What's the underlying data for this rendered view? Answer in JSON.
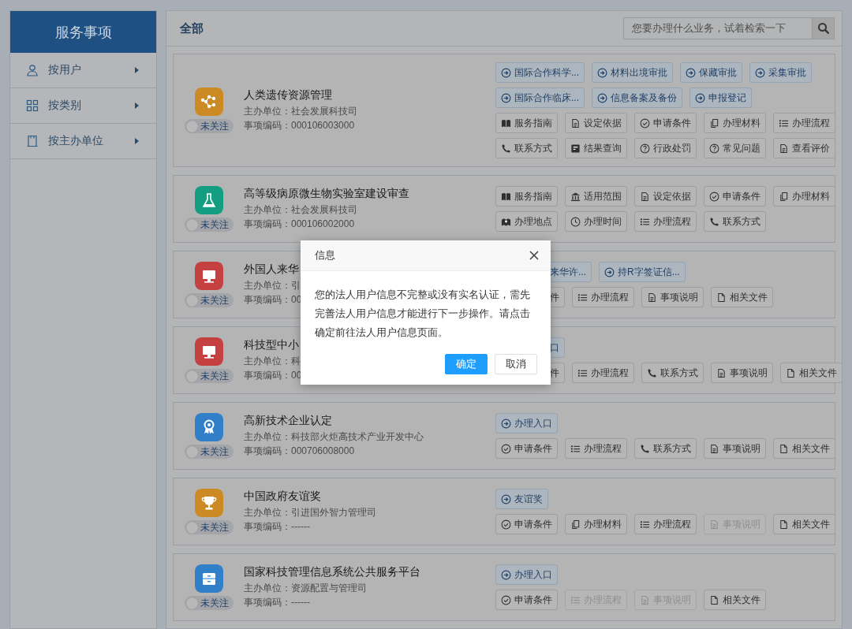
{
  "sidebar": {
    "title": "服务事项",
    "items": [
      {
        "label": "按用户",
        "kind": "user"
      },
      {
        "label": "按类别",
        "kind": "grid"
      },
      {
        "label": "按主办单位",
        "kind": "building"
      }
    ]
  },
  "main": {
    "title": "全部",
    "search": {
      "placeholder": "您要办理什么业务，试着检索一下"
    }
  },
  "items": [
    {
      "title": "人类遗传资源管理",
      "org": "主办单位：社会发展科技司",
      "code": "事项编码：000106003000",
      "kind": "molecule",
      "color": "#cc8a25",
      "follow_label": "未关注",
      "followed": false,
      "button_rows": [
        [
          {
            "label": "国际合作科学...",
            "kind": "entry",
            "disabled": false,
            "clipped": false
          },
          {
            "label": "材料出境审批",
            "kind": "entry",
            "disabled": false,
            "clipped": false
          },
          {
            "label": "保藏审批",
            "kind": "entry",
            "disabled": false,
            "clipped": false
          },
          {
            "label": "采集审批",
            "kind": "entry",
            "disabled": false,
            "clipped": false
          }
        ],
        [
          {
            "label": "国际合作临床...",
            "kind": "entry",
            "disabled": false,
            "clipped": false
          },
          {
            "label": "信息备案及备份",
            "kind": "entry",
            "disabled": false,
            "clipped": false
          },
          {
            "label": "申报登记",
            "kind": "entry",
            "disabled": false,
            "clipped": false
          }
        ],
        [
          {
            "label": "服务指南",
            "kind": "guide",
            "disabled": false,
            "clipped": false
          },
          {
            "label": "设定依据",
            "kind": "doc",
            "disabled": false,
            "clipped": false
          },
          {
            "label": "申请条件",
            "kind": "check",
            "disabled": false,
            "clipped": false
          },
          {
            "label": "办理材料",
            "kind": "copy",
            "disabled": false,
            "clipped": false
          },
          {
            "label": "办理流程",
            "kind": "list",
            "disabled": false,
            "clipped": false
          }
        ],
        [
          {
            "label": "联系方式",
            "kind": "phone",
            "disabled": false,
            "clipped": false
          },
          {
            "label": "结果查询",
            "kind": "result",
            "disabled": false,
            "clipped": false
          },
          {
            "label": "行政处罚",
            "kind": "question",
            "disabled": false,
            "clipped": false
          },
          {
            "label": "常见问题",
            "kind": "question",
            "disabled": false,
            "clipped": false
          },
          {
            "label": "查看评价",
            "kind": "doc",
            "disabled": false,
            "clipped": false
          }
        ]
      ]
    },
    {
      "title": "高等级病原微生物实验室建设审查",
      "org": "主办单位：社会发展科技司",
      "code": "事项编码：000106002000",
      "kind": "flask",
      "color": "#139e82",
      "follow_label": "未关注",
      "followed": false,
      "button_rows": [
        [
          {
            "label": "服务指南",
            "kind": "guide",
            "disabled": false,
            "clipped": false
          },
          {
            "label": "适用范围",
            "kind": "bank",
            "disabled": false,
            "clipped": false
          },
          {
            "label": "设定依据",
            "kind": "doc",
            "disabled": false,
            "clipped": false
          },
          {
            "label": "申请条件",
            "kind": "check",
            "disabled": false,
            "clipped": false
          },
          {
            "label": "办理材料",
            "kind": "copy",
            "disabled": false,
            "clipped": false
          }
        ],
        [
          {
            "label": "办理地点",
            "kind": "map",
            "disabled": false,
            "clipped": false
          },
          {
            "label": "办理时间",
            "kind": "clock",
            "disabled": false,
            "clipped": false
          },
          {
            "label": "办理流程",
            "kind": "list",
            "disabled": false,
            "clipped": false
          },
          {
            "label": "联系方式",
            "kind": "phone",
            "disabled": false,
            "clipped": false
          }
        ]
      ]
    },
    {
      "title": "外国人来华",
      "org": "主办单位：引",
      "code": "事项编码：00",
      "kind": "monitor",
      "color": "#c54141",
      "follow_label": "未关注",
      "followed": false,
      "button_rows": [
        [
          {
            "label": "来华许...",
            "kind": "entry",
            "disabled": false,
            "clipped": true
          },
          {
            "label": "持R字签证信...",
            "kind": "entry",
            "disabled": false,
            "clipped": false
          }
        ],
        [
          {
            "label": "件",
            "kind": "check",
            "disabled": false,
            "clipped": true
          },
          {
            "label": "办理流程",
            "kind": "list",
            "disabled": false,
            "clipped": false
          },
          {
            "label": "事项说明",
            "kind": "doc",
            "disabled": false,
            "clipped": false
          },
          {
            "label": "相关文件",
            "kind": "file",
            "disabled": false,
            "clipped": false
          }
        ]
      ]
    },
    {
      "title": "科技型中小",
      "org": "主办单位：科",
      "code": "事项编码：00",
      "kind": "monitor",
      "color": "#c54141",
      "follow_label": "未关注",
      "followed": false,
      "button_rows": [
        [
          {
            "label": "口",
            "kind": "entry",
            "disabled": false,
            "clipped": true
          }
        ],
        [
          {
            "label": "件",
            "kind": "check",
            "disabled": false,
            "clipped": true
          },
          {
            "label": "办理流程",
            "kind": "list",
            "disabled": false,
            "clipped": false
          },
          {
            "label": "联系方式",
            "kind": "phone",
            "disabled": false,
            "clipped": false
          },
          {
            "label": "事项说明",
            "kind": "doc",
            "disabled": false,
            "clipped": false
          },
          {
            "label": "相关文件",
            "kind": "file",
            "disabled": false,
            "clipped": false
          }
        ]
      ]
    },
    {
      "title": "高新技术企业认定",
      "org": "主办单位：科技部火炬高技术产业开发中心",
      "code": "事项编码：000706008000",
      "kind": "award",
      "color": "#317fc9",
      "follow_label": "未关注",
      "followed": false,
      "button_rows": [
        [
          {
            "label": "办理入口",
            "kind": "entry",
            "disabled": false,
            "clipped": false
          }
        ],
        [
          {
            "label": "申请条件",
            "kind": "check",
            "disabled": false,
            "clipped": false
          },
          {
            "label": "办理流程",
            "kind": "list",
            "disabled": false,
            "clipped": false
          },
          {
            "label": "联系方式",
            "kind": "phone",
            "disabled": false,
            "clipped": false
          },
          {
            "label": "事项说明",
            "kind": "doc",
            "disabled": false,
            "clipped": false
          },
          {
            "label": "相关文件",
            "kind": "file",
            "disabled": false,
            "clipped": false
          }
        ]
      ]
    },
    {
      "title": "中国政府友谊奖",
      "org": "主办单位：引进国外智力管理司",
      "code": "事项编码：------",
      "kind": "trophy",
      "color": "#cc8a25",
      "follow_label": "未关注",
      "followed": false,
      "button_rows": [
        [
          {
            "label": "友谊奖",
            "kind": "entry",
            "disabled": false,
            "clipped": false
          }
        ],
        [
          {
            "label": "申请条件",
            "kind": "check",
            "disabled": false,
            "clipped": false
          },
          {
            "label": "办理材料",
            "kind": "copy",
            "disabled": false,
            "clipped": false
          },
          {
            "label": "办理流程",
            "kind": "list",
            "disabled": false,
            "clipped": false
          },
          {
            "label": "事项说明",
            "kind": "doc",
            "disabled": true,
            "clipped": false
          },
          {
            "label": "相关文件",
            "kind": "file",
            "disabled": false,
            "clipped": false
          }
        ]
      ]
    },
    {
      "title": "国家科技管理信息系统公共服务平台",
      "org": "主办单位：资源配置与管理司",
      "code": "事项编码：------",
      "kind": "cabinet",
      "color": "#317fc9",
      "follow_label": "未关注",
      "followed": false,
      "button_rows": [
        [
          {
            "label": "办理入口",
            "kind": "entry",
            "disabled": false,
            "clipped": false
          }
        ],
        [
          {
            "label": "申请条件",
            "kind": "check",
            "disabled": false,
            "clipped": false
          },
          {
            "label": "办理流程",
            "kind": "list",
            "disabled": true,
            "clipped": false
          },
          {
            "label": "事项说明",
            "kind": "doc",
            "disabled": true,
            "clipped": false
          },
          {
            "label": "相关文件",
            "kind": "file",
            "disabled": false,
            "clipped": false
          }
        ]
      ]
    }
  ],
  "dialog": {
    "title": "信息",
    "message": "您的法人用户信息不完整或没有实名认证，需先完善法人用户信息才能进行下一步操作。请点击确定前往法人用户信息页面。",
    "buttons": [
      {
        "label": "确定",
        "kind": "primary"
      },
      {
        "label": "取消",
        "kind": "default"
      }
    ]
  }
}
